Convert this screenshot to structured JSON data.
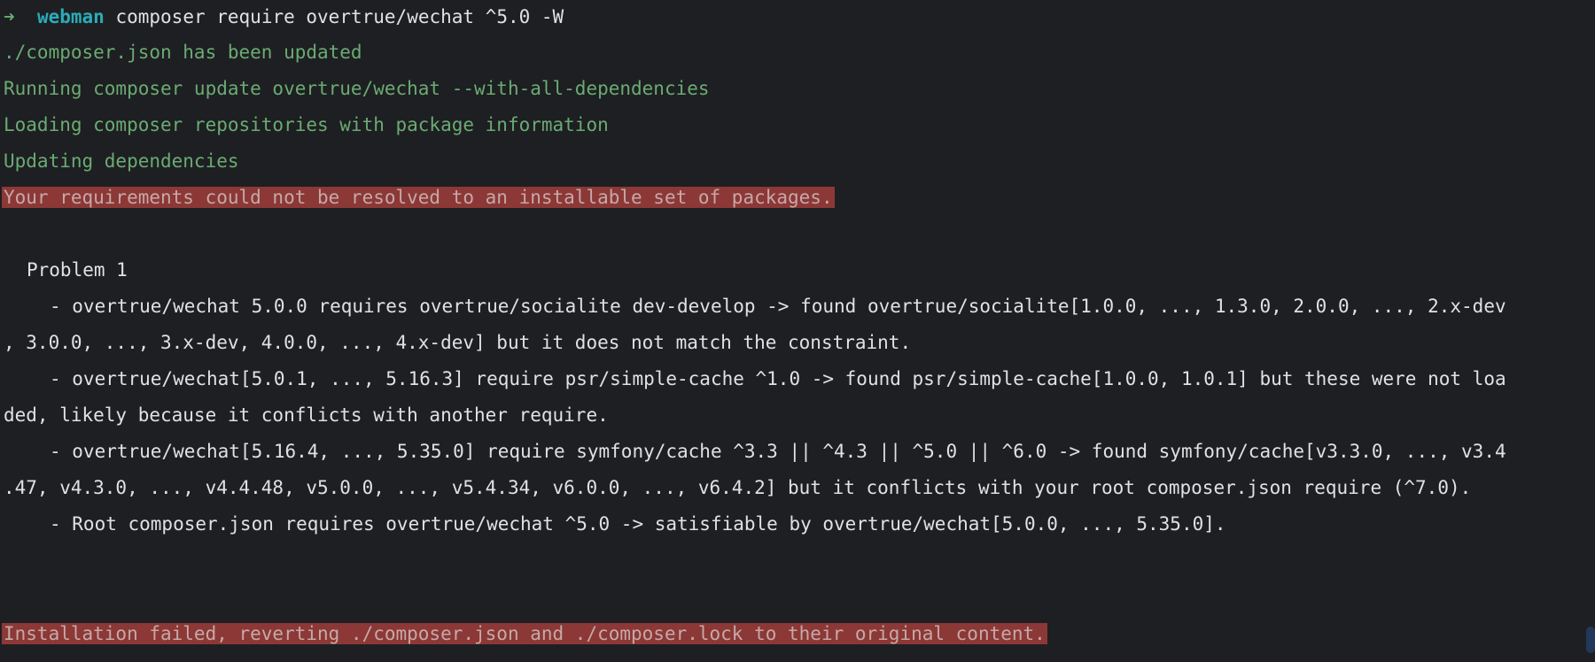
{
  "prompt": {
    "arrow": "➜",
    "dir": "webman",
    "command": "composer require overtrue/wechat ^5.0 -W"
  },
  "output": {
    "l1": "./composer.json has been updated",
    "l2": "Running composer update overtrue/wechat --with-all-dependencies",
    "l3": "Loading composer repositories with package information",
    "l4": "Updating dependencies",
    "error1": "Your requirements could not be resolved to an installable set of packages.",
    "problem_header": "Problem 1",
    "p1a": "- overtrue/wechat 5.0.0 requires overtrue/socialite dev-develop -> found overtrue/socialite[1.0.0, ..., 1.3.0, 2.0.0, ..., 2.x-dev",
    "p1b": ", 3.0.0, ..., 3.x-dev, 4.0.0, ..., 4.x-dev] but it does not match the constraint.",
    "p2a": "- overtrue/wechat[5.0.1, ..., 5.16.3] require psr/simple-cache ^1.0 -> found psr/simple-cache[1.0.0, 1.0.1] but these were not loa",
    "p2b": "ded, likely because it conflicts with another require.",
    "p3a": "- overtrue/wechat[5.16.4, ..., 5.35.0] require symfony/cache ^3.3 || ^4.3 || ^5.0 || ^6.0 -> found symfony/cache[v3.3.0, ..., v3.4",
    "p3b": ".47, v4.3.0, ..., v4.4.48, v5.0.0, ..., v5.4.34, v6.0.0, ..., v6.4.2] but it conflicts with your root composer.json require (^7.0).",
    "p4": "- Root composer.json requires overtrue/wechat ^5.0 -> satisfiable by overtrue/wechat[5.0.0, ..., 5.35.0].",
    "error2": "Installation failed, reverting ./composer.json and ./composer.lock to their original content."
  },
  "colors": {
    "background": "#1e1f22",
    "info_green": "#6aab73",
    "error_bg": "#8c3836",
    "prompt_dir": "#2aacb8"
  }
}
